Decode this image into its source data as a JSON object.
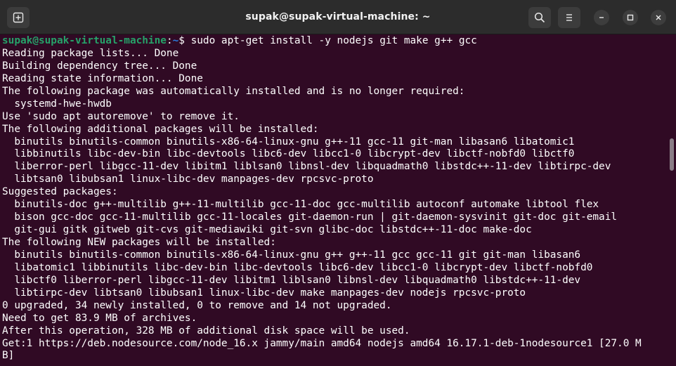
{
  "window": {
    "title": "supak@supak-virtual-machine: ~"
  },
  "icons": {
    "new_tab": "new-tab-icon",
    "search": "search-icon",
    "menu": "hamburger-menu-icon",
    "minimize": "minimize-icon",
    "maximize": "maximize-icon",
    "close": "close-icon"
  },
  "colors": {
    "terminal_bg": "#300a24",
    "prompt_user": "#26a269",
    "prompt_path": "#2a7bde",
    "titlebar_bg": "#2c2c2c"
  },
  "prompt": {
    "user_host": "supak@supak-virtual-machine",
    "separator": ":",
    "path": "~",
    "symbol": "$ ",
    "command": "sudo apt-get install -y nodejs git make g++ gcc"
  },
  "output_lines": [
    "Reading package lists... Done",
    "Building dependency tree... Done",
    "Reading state information... Done",
    "The following package was automatically installed and is no longer required:",
    "  systemd-hwe-hwdb",
    "Use 'sudo apt autoremove' to remove it.",
    "The following additional packages will be installed:",
    "  binutils binutils-common binutils-x86-64-linux-gnu g++-11 gcc-11 git-man libasan6 libatomic1",
    "  libbinutils libc-dev-bin libc-devtools libc6-dev libcc1-0 libcrypt-dev libctf-nobfd0 libctf0",
    "  liberror-perl libgcc-11-dev libitm1 liblsan0 libnsl-dev libquadmath0 libstdc++-11-dev libtirpc-dev",
    "  libtsan0 libubsan1 linux-libc-dev manpages-dev rpcsvc-proto",
    "Suggested packages:",
    "  binutils-doc g++-multilib g++-11-multilib gcc-11-doc gcc-multilib autoconf automake libtool flex",
    "  bison gcc-doc gcc-11-multilib gcc-11-locales git-daemon-run | git-daemon-sysvinit git-doc git-email",
    "  git-gui gitk gitweb git-cvs git-mediawiki git-svn glibc-doc libstdc++-11-doc make-doc",
    "The following NEW packages will be installed:",
    "  binutils binutils-common binutils-x86-64-linux-gnu g++ g++-11 gcc gcc-11 git git-man libasan6",
    "  libatomic1 libbinutils libc-dev-bin libc-devtools libc6-dev libcc1-0 libcrypt-dev libctf-nobfd0",
    "  libctf0 liberror-perl libgcc-11-dev libitm1 liblsan0 libnsl-dev libquadmath0 libstdc++-11-dev",
    "  libtirpc-dev libtsan0 libubsan1 linux-libc-dev make manpages-dev nodejs rpcsvc-proto",
    "0 upgraded, 34 newly installed, 0 to remove and 14 not upgraded.",
    "Need to get 83.9 MB of archives.",
    "After this operation, 328 MB of additional disk space will be used.",
    "Get:1 https://deb.nodesource.com/node_16.x jammy/main amd64 nodejs amd64 16.17.1-deb-1nodesource1 [27.0 M",
    "B]"
  ]
}
